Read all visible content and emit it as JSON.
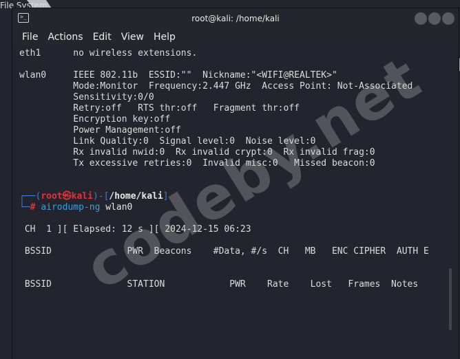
{
  "desktop": {
    "label": "File System"
  },
  "window": {
    "title": "root@kali: /home/kali",
    "menu": [
      "File",
      "Actions",
      "Edit",
      "View",
      "Help"
    ]
  },
  "terminal": {
    "lines": [
      "eth1      no wireless extensions.",
      "",
      "wlan0     IEEE 802.11b  ESSID:\"\"  Nickname:\"<WIFI@REALTEK>\"",
      "          Mode:Monitor  Frequency:2.447 GHz  Access Point: Not-Associated",
      "          Sensitivity:0/0",
      "          Retry:off   RTS thr:off   Fragment thr:off",
      "          Encryption key:off",
      "          Power Management:off",
      "          Link Quality:0  Signal level:0  Noise level:0",
      "          Rx invalid nwid:0  Rx invalid crypt:0  Rx invalid frag:0",
      "          Tx excessive retries:0  Invalid misc:0   Missed beacon:0"
    ],
    "prompt": {
      "open": "┌──(",
      "user": "root㉿kali",
      "mid": ")-[",
      "path": "/home/kali",
      "close": "]",
      "second": "└─",
      "hash": "#",
      "command": "airodump-ng",
      "argument": "wlan0"
    },
    "airodump": {
      "status": " CH  1 ][ Elapsed: 12 s ][ 2024-12-15 06:23",
      "ap_header": " BSSID              PWR  Beacons    #Data, #/s  CH   MB   ENC CIPHER  AUTH E",
      "station_header": " BSSID              STATION            PWR    Rate    Lost   Frames  Notes"
    }
  },
  "watermark": "codeby.net",
  "colors": {
    "terminal_bg": "#24242e",
    "prompt_blue": "#3b7fd6",
    "prompt_red": "#e0343a",
    "command_blue": "#3b9de0"
  }
}
